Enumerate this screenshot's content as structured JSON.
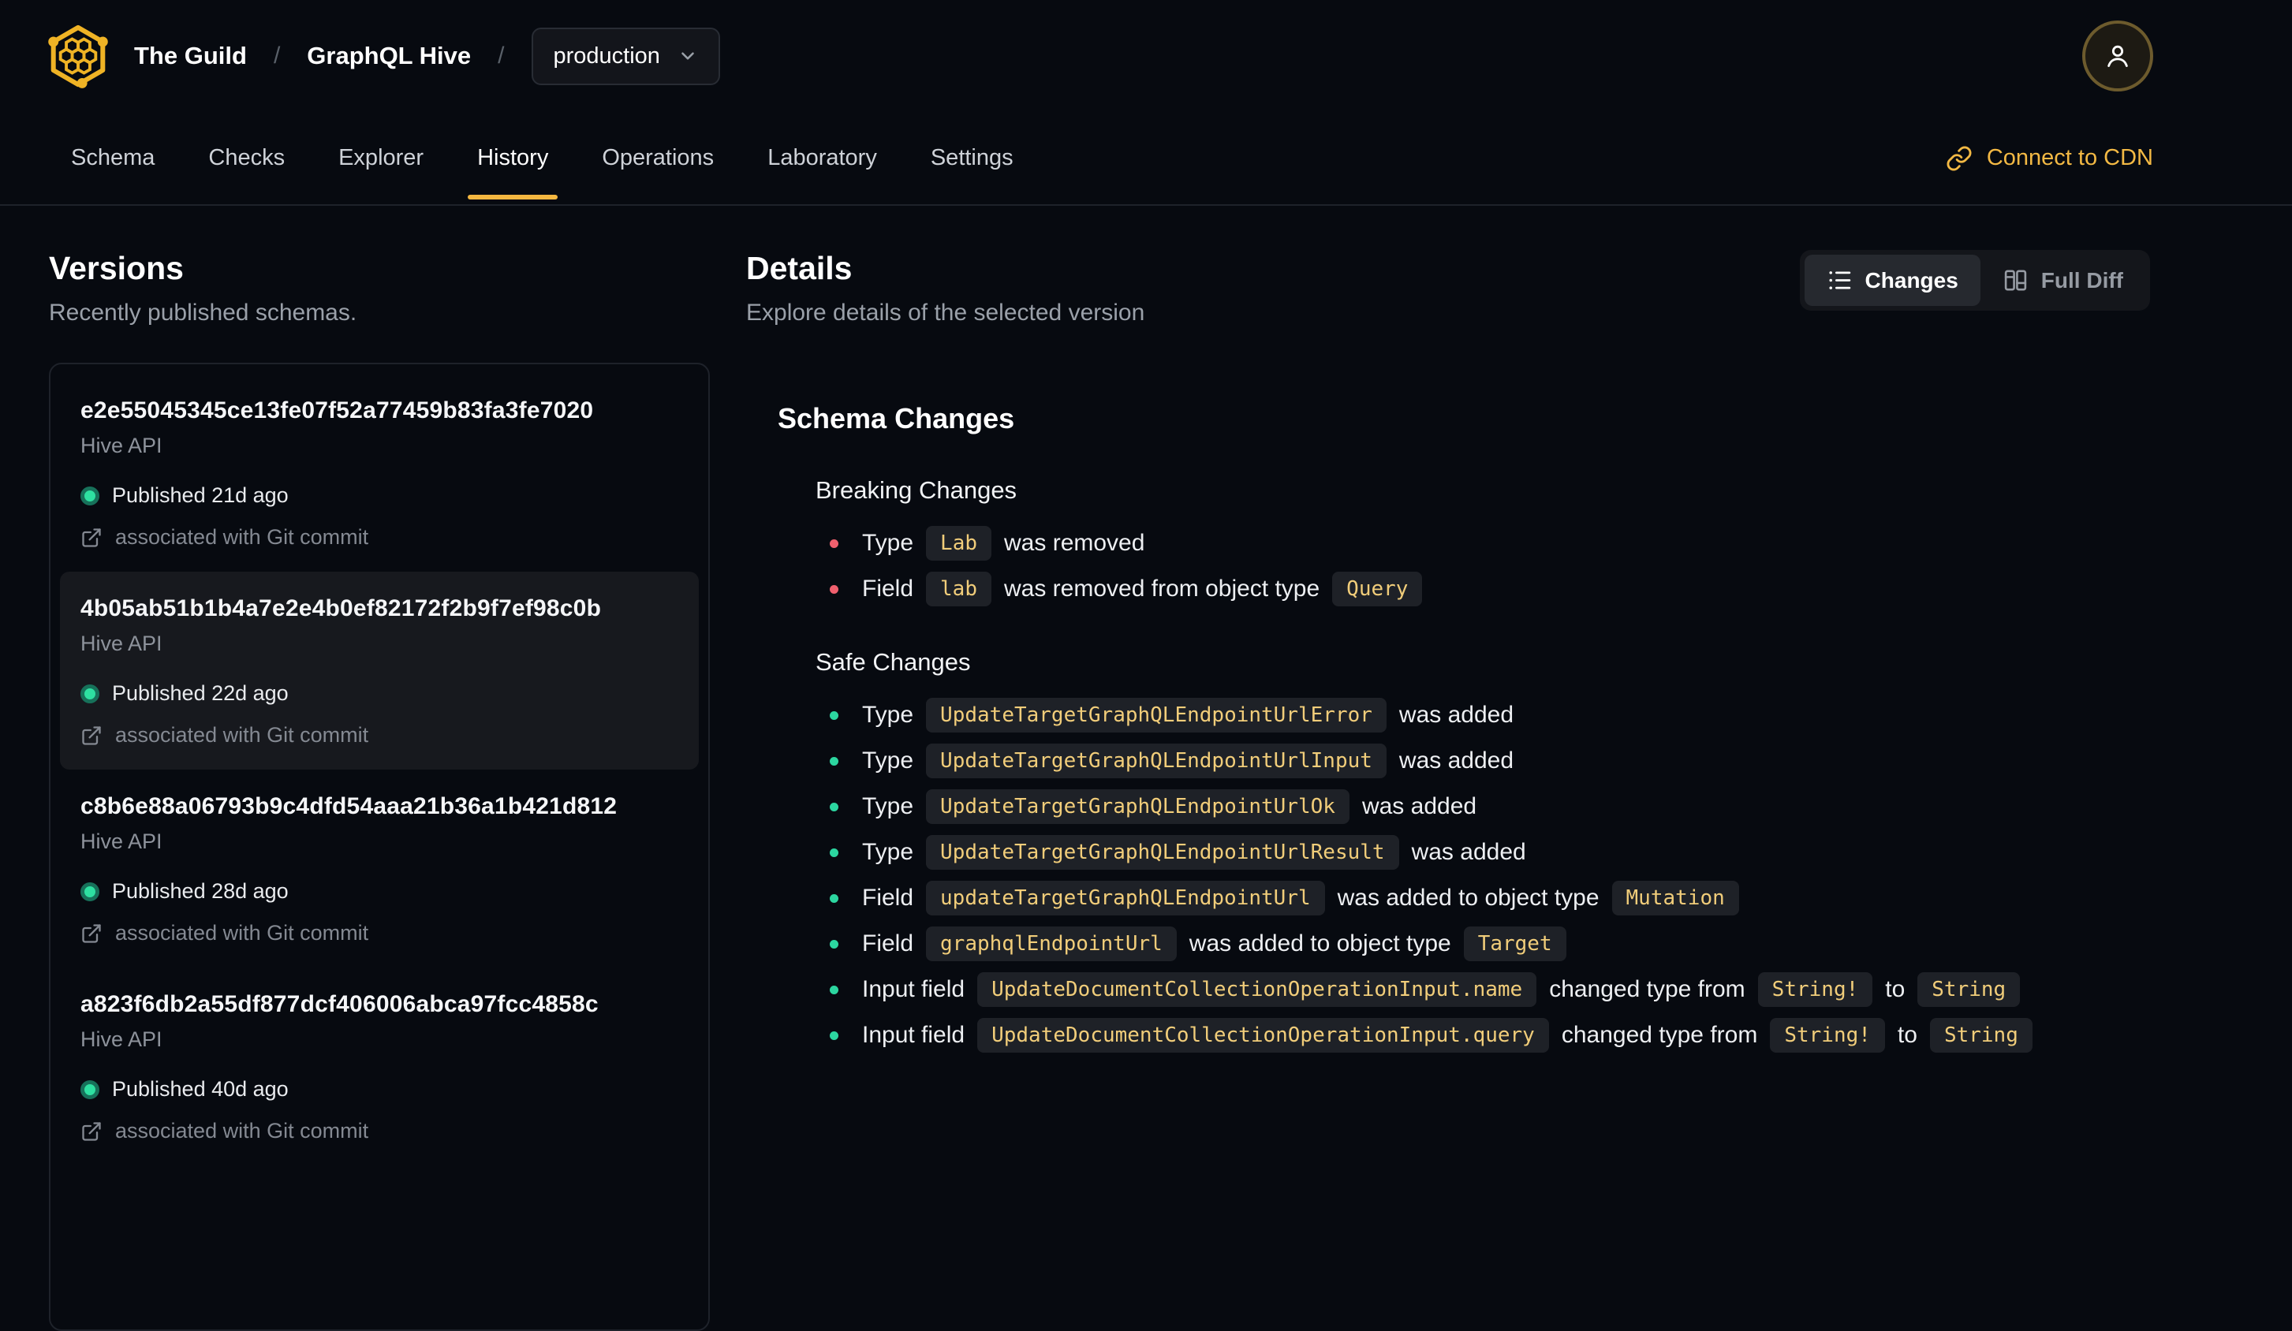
{
  "header": {
    "breadcrumb": {
      "org": "The Guild",
      "separator": "/",
      "project": "GraphQL Hive",
      "target": "production"
    },
    "logo_name": "hive-honeycomb-logo",
    "avatar_icon": "person-icon"
  },
  "nav": {
    "tabs": [
      {
        "label": "Schema",
        "active": false
      },
      {
        "label": "Checks",
        "active": false
      },
      {
        "label": "Explorer",
        "active": false
      },
      {
        "label": "History",
        "active": true
      },
      {
        "label": "Operations",
        "active": false
      },
      {
        "label": "Laboratory",
        "active": false
      },
      {
        "label": "Settings",
        "active": false
      }
    ],
    "cdn_link": "Connect to CDN"
  },
  "versions_panel": {
    "title": "Versions",
    "subtitle": "Recently published schemas.",
    "items": [
      {
        "hash": "e2e55045345ce13fe07f52a77459b83fa3fe7020",
        "service": "Hive API",
        "published": "Published 21d ago",
        "git": "associated with Git commit",
        "selected": false
      },
      {
        "hash": "4b05ab51b1b4a7e2e4b0ef82172f2b9f7ef98c0b",
        "service": "Hive API",
        "published": "Published 22d ago",
        "git": "associated with Git commit",
        "selected": true
      },
      {
        "hash": "c8b6e88a06793b9c4dfd54aaa21b36a1b421d812",
        "service": "Hive API",
        "published": "Published 28d ago",
        "git": "associated with Git commit",
        "selected": false
      },
      {
        "hash": "a823f6db2a55df877dcf406006abca97fcc4858c",
        "service": "Hive API",
        "published": "Published 40d ago",
        "git": "associated with Git commit",
        "selected": false
      }
    ]
  },
  "details_panel": {
    "title": "Details",
    "subtitle": "Explore details of the selected version",
    "view_toggle": {
      "changes": "Changes",
      "full_diff": "Full Diff",
      "active": "Changes",
      "changes_icon": "list-icon",
      "full_diff_icon": "split-columns-icon"
    },
    "schema_changes": {
      "title": "Schema Changes",
      "sections": [
        {
          "title": "Breaking Changes",
          "severity": "breaking",
          "items": [
            [
              {
                "t": "text",
                "v": "Type"
              },
              {
                "t": "code",
                "v": "Lab"
              },
              {
                "t": "text",
                "v": "was removed"
              }
            ],
            [
              {
                "t": "text",
                "v": "Field"
              },
              {
                "t": "code",
                "v": "lab"
              },
              {
                "t": "text",
                "v": "was removed from object type"
              },
              {
                "t": "code",
                "v": "Query"
              }
            ]
          ]
        },
        {
          "title": "Safe Changes",
          "severity": "safe",
          "items": [
            [
              {
                "t": "text",
                "v": "Type"
              },
              {
                "t": "code",
                "v": "UpdateTargetGraphQLEndpointUrlError"
              },
              {
                "t": "text",
                "v": "was added"
              }
            ],
            [
              {
                "t": "text",
                "v": "Type"
              },
              {
                "t": "code",
                "v": "UpdateTargetGraphQLEndpointUrlInput"
              },
              {
                "t": "text",
                "v": "was added"
              }
            ],
            [
              {
                "t": "text",
                "v": "Type"
              },
              {
                "t": "code",
                "v": "UpdateTargetGraphQLEndpointUrlOk"
              },
              {
                "t": "text",
                "v": "was added"
              }
            ],
            [
              {
                "t": "text",
                "v": "Type"
              },
              {
                "t": "code",
                "v": "UpdateTargetGraphQLEndpointUrlResult"
              },
              {
                "t": "text",
                "v": "was added"
              }
            ],
            [
              {
                "t": "text",
                "v": "Field"
              },
              {
                "t": "code",
                "v": "updateTargetGraphQLEndpointUrl"
              },
              {
                "t": "text",
                "v": "was added to object type"
              },
              {
                "t": "code",
                "v": "Mutation"
              }
            ],
            [
              {
                "t": "text",
                "v": "Field"
              },
              {
                "t": "code",
                "v": "graphqlEndpointUrl"
              },
              {
                "t": "text",
                "v": "was added to object type"
              },
              {
                "t": "code",
                "v": "Target"
              }
            ],
            [
              {
                "t": "text",
                "v": "Input field"
              },
              {
                "t": "code",
                "v": "UpdateDocumentCollectionOperationInput.name"
              },
              {
                "t": "text",
                "v": "changed type from"
              },
              {
                "t": "code",
                "v": "String!"
              },
              {
                "t": "text",
                "v": "to"
              },
              {
                "t": "code",
                "v": "String"
              }
            ],
            [
              {
                "t": "text",
                "v": "Input field"
              },
              {
                "t": "code",
                "v": "UpdateDocumentCollectionOperationInput.query"
              },
              {
                "t": "text",
                "v": "changed type from"
              },
              {
                "t": "code",
                "v": "String!"
              },
              {
                "t": "text",
                "v": "to"
              },
              {
                "t": "code",
                "v": "String"
              }
            ]
          ]
        }
      ]
    }
  },
  "colors": {
    "background": "#070a10",
    "accent_yellow": "#f4b740",
    "breaking_bullet": "#f0606e",
    "safe_bullet": "#2cd6a0",
    "published_dot": "#2ee0a1",
    "code_text": "#f1cd7a",
    "code_bg": "#1e2127",
    "selected_card_bg": "#17191e"
  }
}
